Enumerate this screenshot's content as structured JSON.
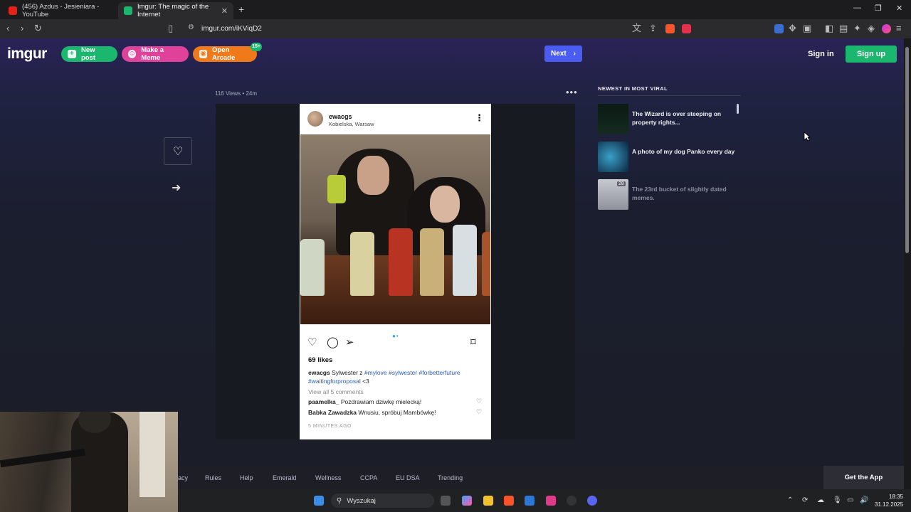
{
  "browser": {
    "tabs": [
      {
        "title": "(456) Azdus - Jesieniara - YouTube",
        "active": false
      },
      {
        "title": "Imgur: The magic of the Internet",
        "active": true
      }
    ],
    "url": "imgur.com/iKViqD2"
  },
  "header": {
    "logo": "imgur",
    "new_post": "New post",
    "make_meme": "Make a Meme",
    "open_arcade": "Open Arcade",
    "arcade_badge": "15+",
    "next": "Next",
    "sign_in": "Sign in",
    "sign_up": "Sign up"
  },
  "post": {
    "views": "116 Views",
    "age": "24m",
    "instagram": {
      "username": "ewacgs",
      "location": "Kobielska, Warsaw",
      "likes": "69 likes",
      "caption_user": "ewacgs",
      "caption_text": "Sylwester z",
      "hashtags": [
        "#mylove",
        "#sylwester",
        "#forbetterfuture",
        "#waitingforproposal"
      ],
      "caption_end": "<3",
      "view_all": "View all 5 comments",
      "comments": [
        {
          "user": "paamelka_",
          "text": "Pozdrawiam dziwkę mielecką!"
        },
        {
          "user": "Babka Zawadzka",
          "text": "Wnusiu, spróbuj Mambówkę!"
        }
      ],
      "time_ago": "5 MINUTES AGO"
    }
  },
  "sidebar": {
    "title": "NEWEST IN MOST VIRAL",
    "items": [
      {
        "title": "The Wizard is over steeping on property rights...",
        "count": ""
      },
      {
        "title": "A photo of my dog Panko every day",
        "count": ""
      },
      {
        "title": "The 23rd bucket of slightly dated memes.",
        "count": "28"
      }
    ]
  },
  "footer": {
    "links": [
      "acy",
      "Rules",
      "Help",
      "Emerald",
      "Wellness",
      "CCPA",
      "EU DSA",
      "Trending"
    ],
    "get_app": "Get the App"
  },
  "taskbar": {
    "search_placeholder": "Wyszukaj",
    "time": "18:35",
    "date": "31.12.2025"
  }
}
